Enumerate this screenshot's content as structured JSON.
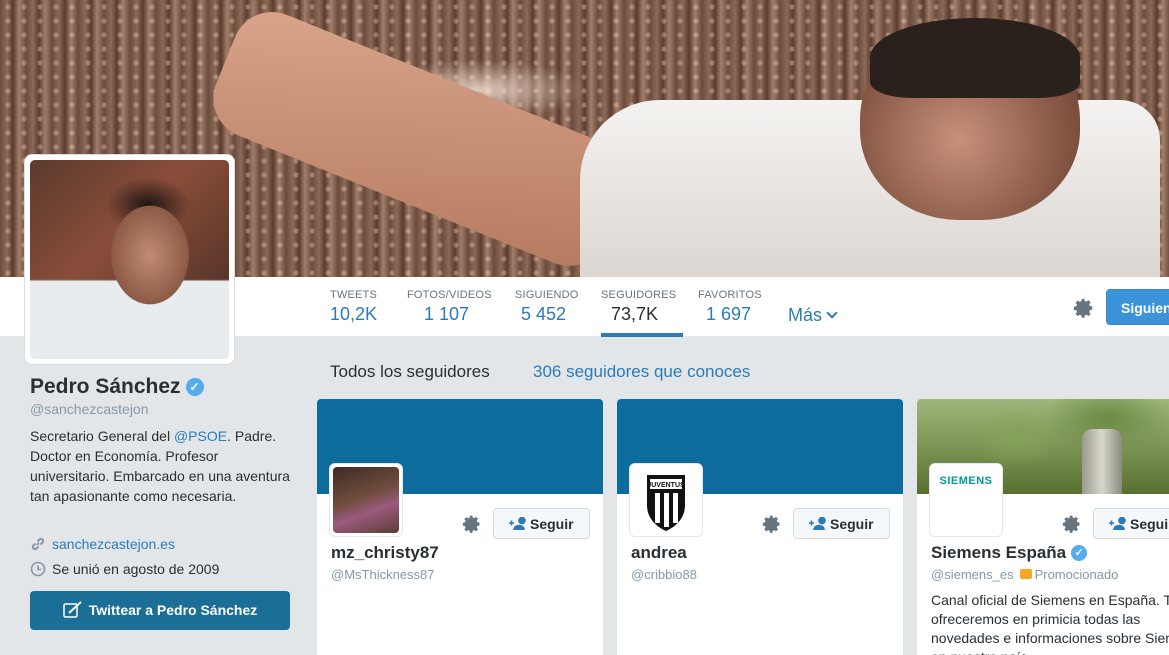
{
  "profile": {
    "name": "Pedro Sánchez",
    "handle": "@sanchezcastejon",
    "bio_before": "Secretario General del ",
    "bio_mention": "@PSOE",
    "bio_after": ". Padre. Doctor en Economía. Profesor universitario. Embarcado en una aventura tan apasionante como necesaria.",
    "website": "sanchezcastejon.es",
    "joined": "Se unió en agosto de 2009",
    "tweet_button": "Twittear a Pedro Sánchez"
  },
  "stats": [
    {
      "label": "TWEETS",
      "value": "10,2K"
    },
    {
      "label": "FOTOS/VIDEOS",
      "value": "1 107"
    },
    {
      "label": "SIGUIENDO",
      "value": "5 452"
    },
    {
      "label": "SEGUIDORES",
      "value": "73,7K"
    },
    {
      "label": "FAVORITOS",
      "value": "1 697"
    }
  ],
  "more_label": "Más",
  "follow_top_label": "Siguien",
  "tabs": {
    "all": "Todos los seguidores",
    "known": "306 seguidores que conoces"
  },
  "cards": [
    {
      "name": "mz_christy87",
      "handle": "@MsThickness87",
      "follow": "Seguir"
    },
    {
      "name": "andrea",
      "handle": "@cribbio88",
      "follow": "Seguir"
    },
    {
      "name": "Siemens España",
      "handle": "@siemens_es",
      "promoted": "Promocionado",
      "follow": "Seguir",
      "logo_text": "SIEMENS",
      "bio": "Canal oficial de Siemens en España. Te ofreceremos en primicia todas las novedades e informaciones sobre Siemens en nuestro país."
    }
  ],
  "colors": {
    "link": "#2b7bb9",
    "cover": "#0d6c9c",
    "tweet_button": "#1b6f96"
  }
}
